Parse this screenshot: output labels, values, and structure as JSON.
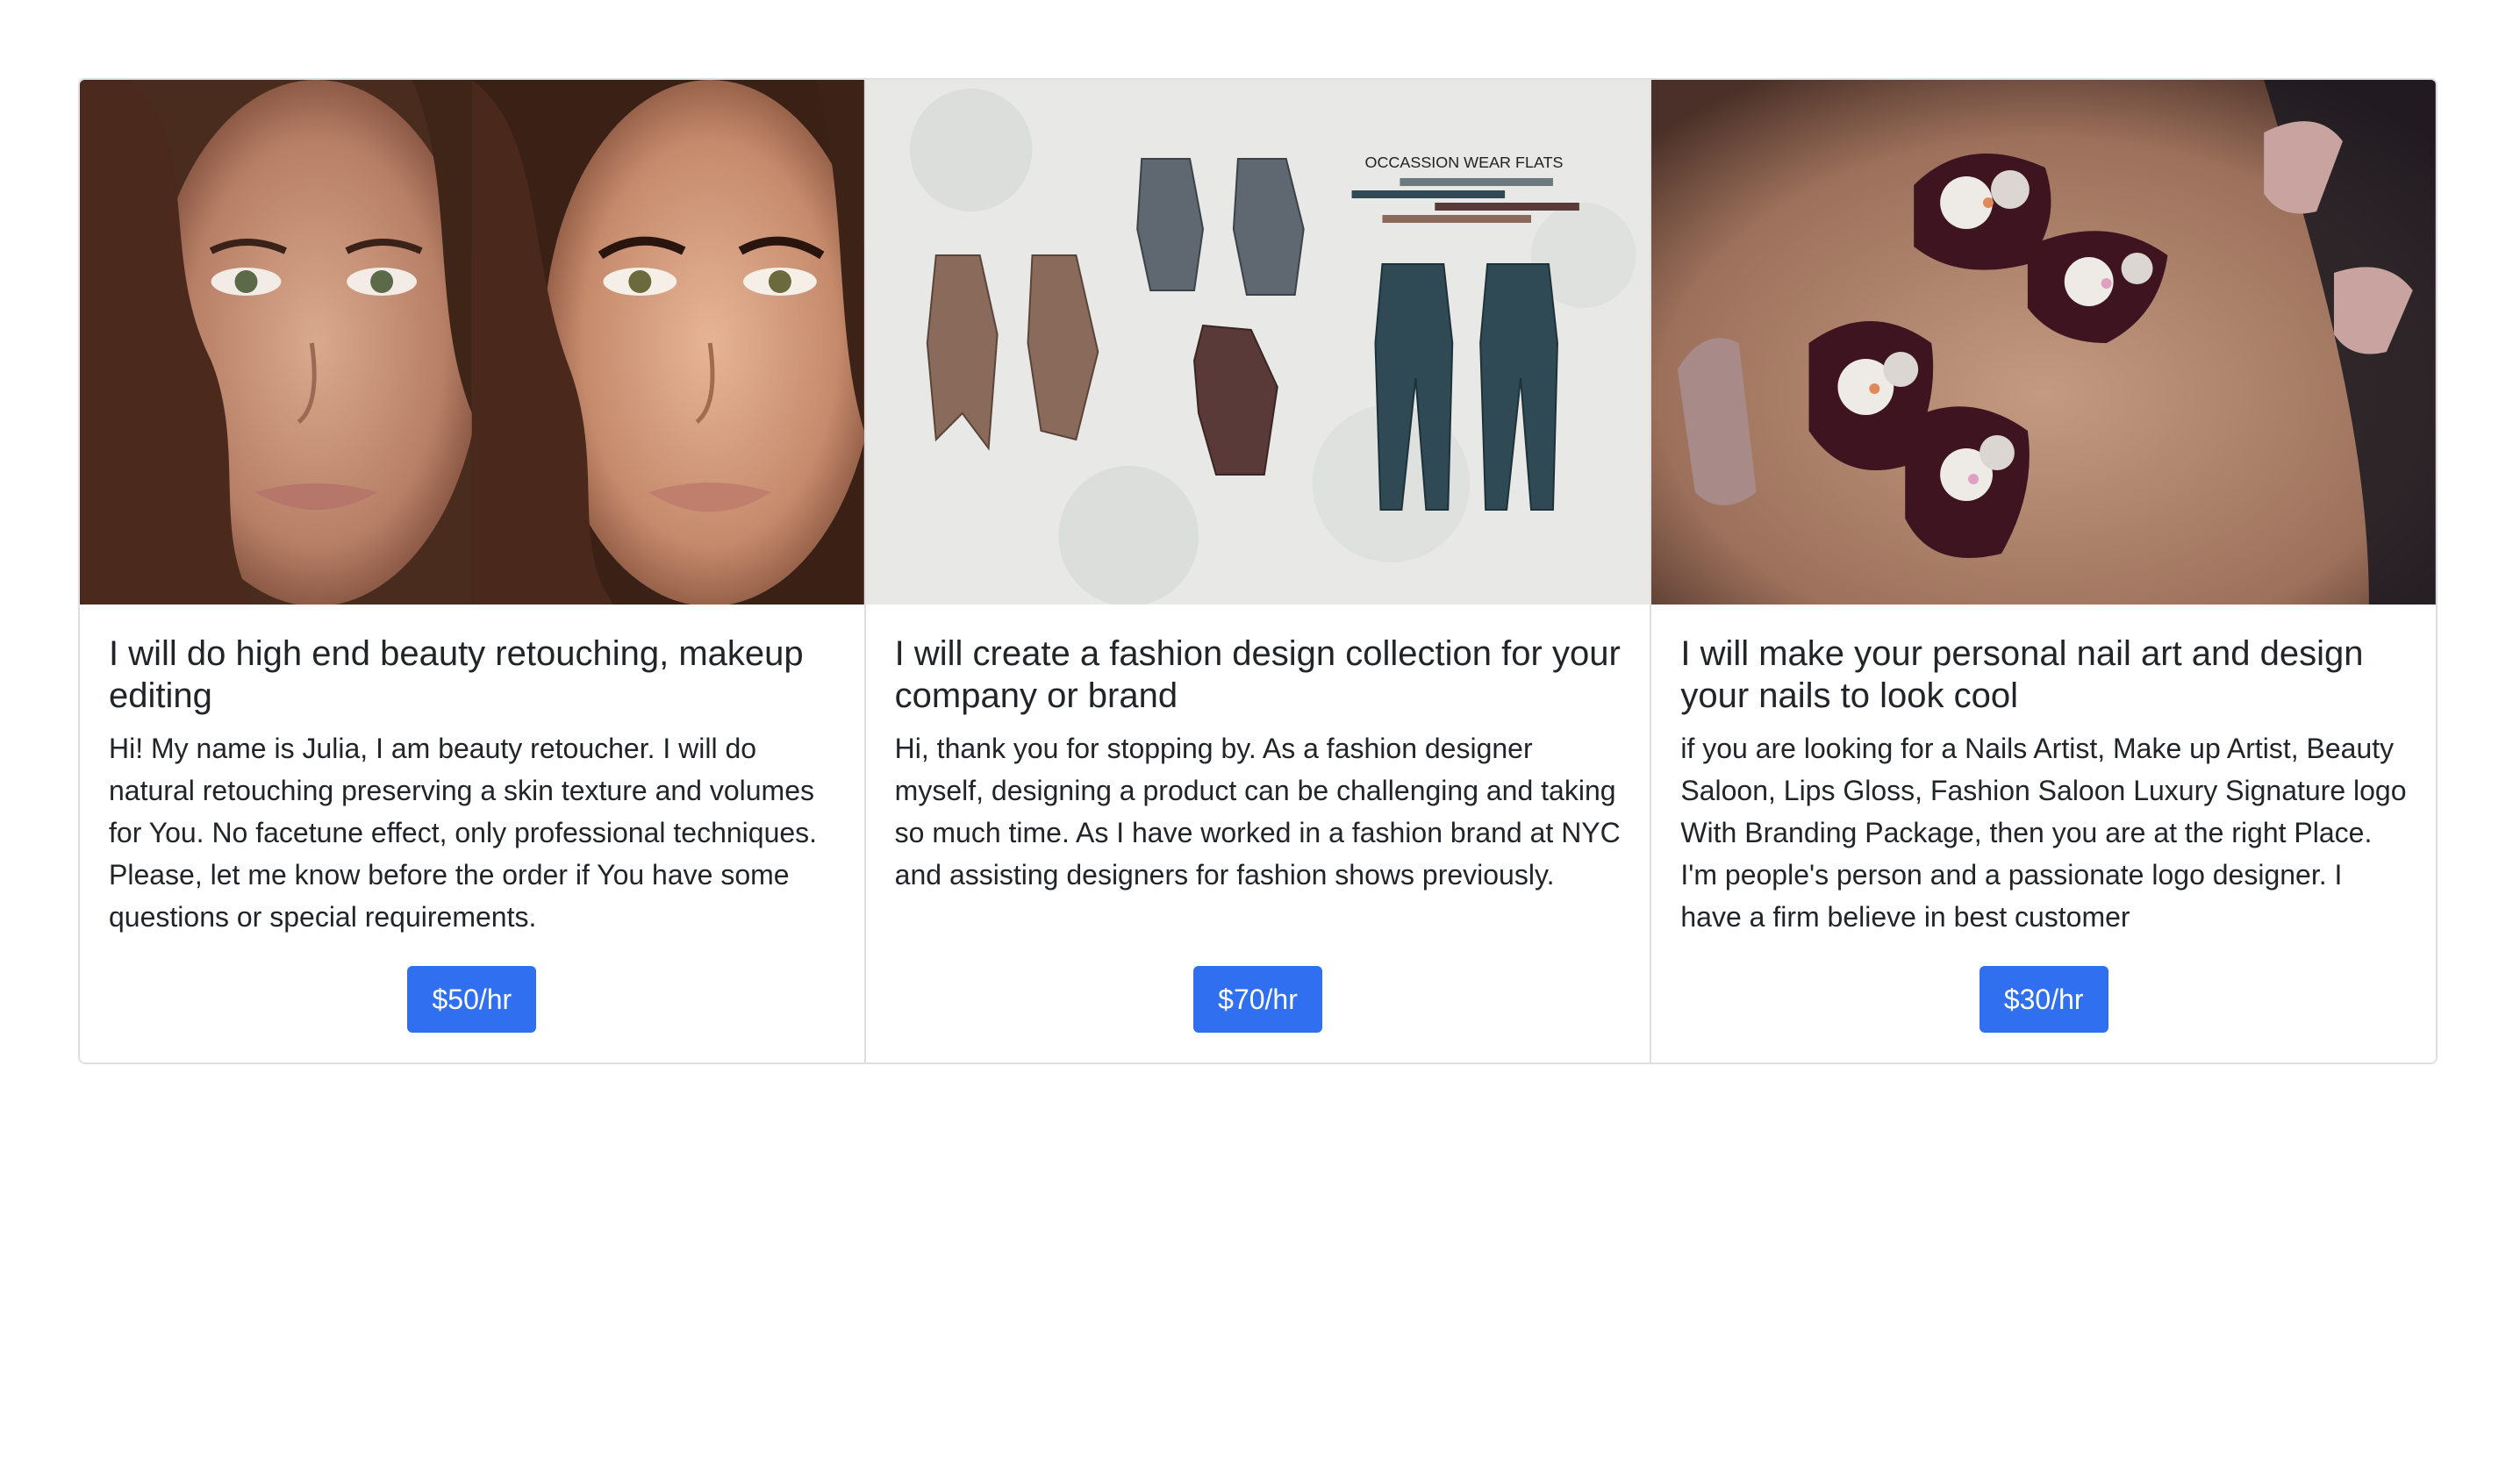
{
  "cards": [
    {
      "image_alt": "beauty retouching before and after portrait",
      "title": "I will do high end beauty retouching, makeup editing",
      "text": "Hi! My name is Julia, I am beauty retoucher. I will do natural retouching preserving a skin texture and volumes for You. No facetune effect, only professional techniques. Please, let me know before the order if You have some questions or special requirements.",
      "price": "$50/hr"
    },
    {
      "image_alt": "fashion design flats illustration",
      "image_caption": "OCCASSION WEAR FLATS",
      "title": "I will create a fashion design collection for your company or brand",
      "text": "Hi, thank you for stopping by. As a fashion designer myself, designing a product can be challenging and taking so much time. As I have worked in a fashion brand at NYC and assisting designers for fashion shows previously.",
      "price": "$70/hr"
    },
    {
      "image_alt": "floral nail art on burgundy nails",
      "title": "I will make your personal nail art and design your nails to look cool",
      "text": "if you are looking for a Nails Artist, Make up Artist, Beauty Saloon, Lips Gloss, Fashion Saloon Luxury Signature logo With Branding Package, then you are at the right Place. I'm people's person and a passionate logo designer. I have a firm believe in best customer",
      "price": "$30/hr"
    }
  ],
  "colors": {
    "button": "#2f6ff0",
    "border": "#dfdfdf",
    "text": "#212529"
  }
}
